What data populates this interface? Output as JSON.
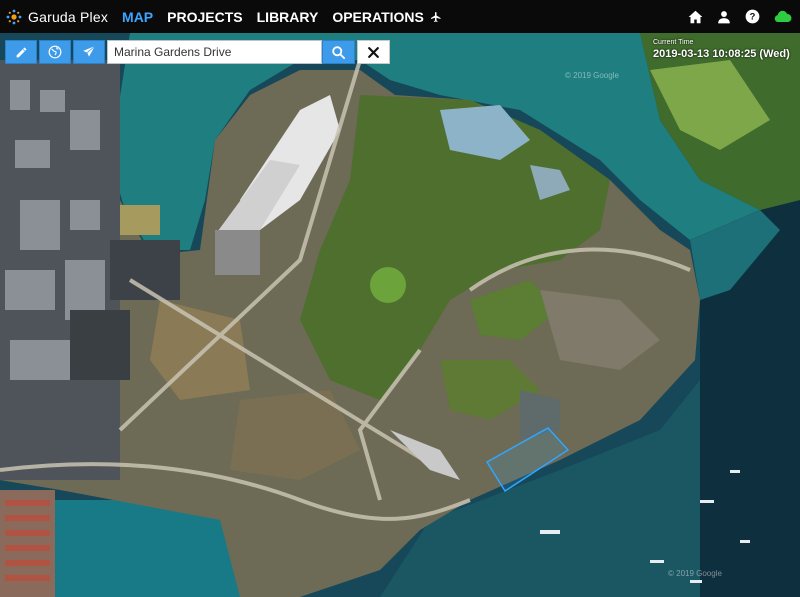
{
  "app": {
    "title": "Garuda Plex"
  },
  "nav": {
    "items": [
      {
        "label": "MAP",
        "active": true
      },
      {
        "label": "PROJECTS",
        "active": false
      },
      {
        "label": "LIBRARY",
        "active": false
      },
      {
        "label": "OPERATIONS",
        "active": false
      }
    ],
    "icons": [
      "home-icon",
      "user-icon",
      "help-icon",
      "cloud-icon"
    ]
  },
  "toolbar": {
    "tools": [
      "pencil-icon",
      "globe-icon",
      "paper-plane-icon"
    ],
    "search": {
      "value": "Marina Gardens Drive",
      "placeholder": ""
    },
    "search_icon": "search-icon",
    "clear_icon": "close-icon"
  },
  "time": {
    "label": "Current Time",
    "value": "2019-03-13 10:08:25 (Wed)"
  },
  "map": {
    "watermarks": [
      "© 2019 Google",
      "© 2019 Google"
    ],
    "colors": {
      "water": "#1f7a7c",
      "sea": "#0f3a4c",
      "land": "#6e6a55",
      "park": "#4f6f2e",
      "selection": "#2fa6ff"
    }
  }
}
